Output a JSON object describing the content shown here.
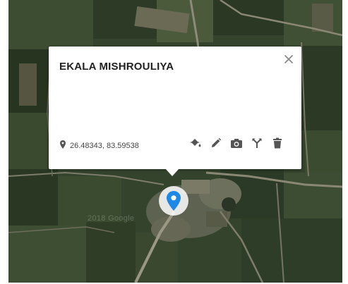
{
  "popup": {
    "title": "EKALA MISHROULIYA",
    "coordinates": "26.48343, 83.59538",
    "close_icon": "close-icon",
    "actions": [
      {
        "name": "fill-color-icon"
      },
      {
        "name": "edit-pencil-icon"
      },
      {
        "name": "camera-icon"
      },
      {
        "name": "directions-icon"
      },
      {
        "name": "delete-trash-icon"
      }
    ]
  },
  "map": {
    "watermark": "2018 Google",
    "marker_color": "#1e88e5",
    "marker_icon": "map-pin-icon"
  }
}
